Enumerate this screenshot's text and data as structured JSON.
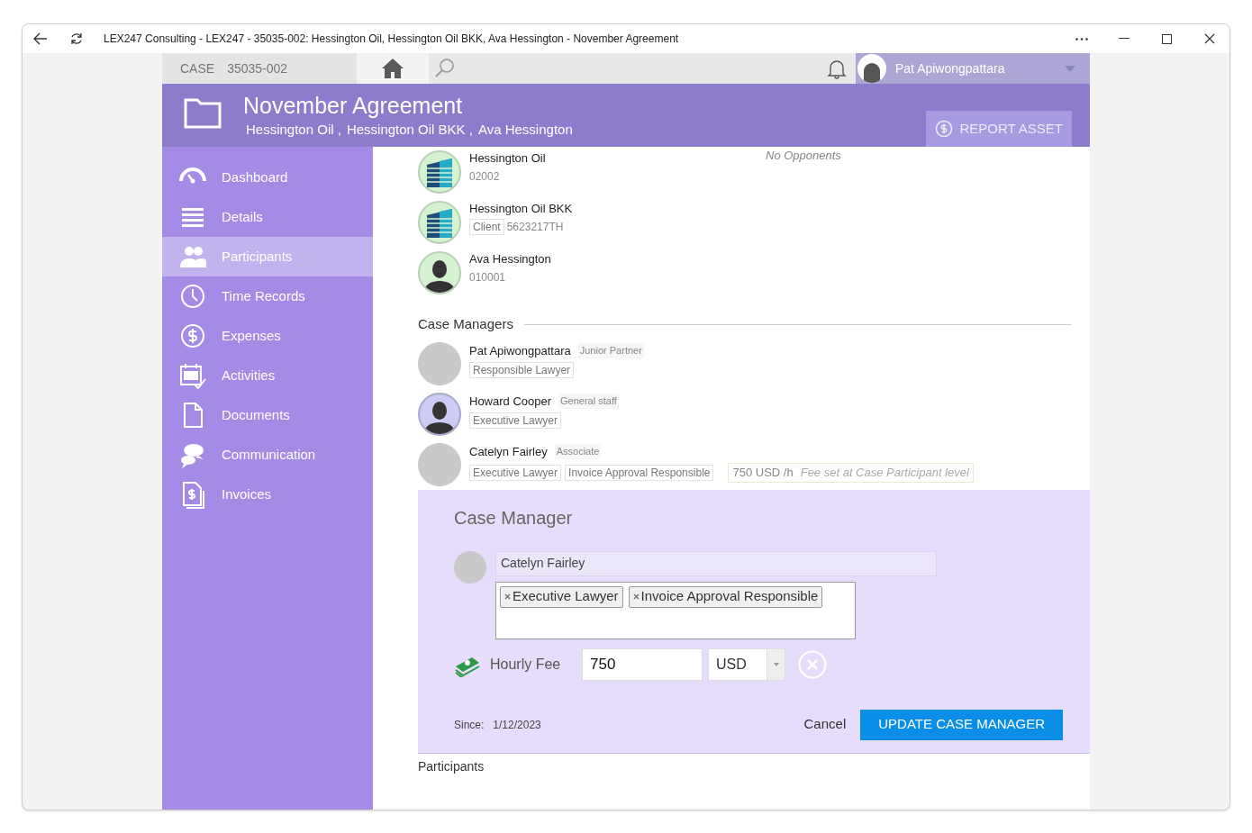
{
  "window": {
    "title": "LEX247 Consulting - LEX247 - 35035-002: Hessington Oil, Hessington Oil BKK, Ava Hessington - November Agreement"
  },
  "topbar": {
    "case_label": "CASE",
    "case_number": "35035-002",
    "user": "Pat Apiwongpattara"
  },
  "header": {
    "title": "November Agreement",
    "subtitle": [
      "Hessington Oil ,",
      "Hessington Oil BKK ,",
      "Ava Hessington"
    ],
    "action": "REPORT ASSET"
  },
  "sidebar": {
    "items": [
      {
        "label": "Dashboard",
        "selected": false
      },
      {
        "label": "Details",
        "selected": false
      },
      {
        "label": "Participants",
        "selected": true
      },
      {
        "label": "Time Records",
        "selected": false
      },
      {
        "label": "Expenses",
        "selected": false
      },
      {
        "label": "Activities",
        "selected": false
      },
      {
        "label": "Documents",
        "selected": false
      },
      {
        "label": "Communication",
        "selected": false
      },
      {
        "label": "Invoices",
        "selected": false
      }
    ]
  },
  "opponents": {
    "empty_text": "No Opponents"
  },
  "clients": [
    {
      "kind": "company",
      "name": "Hessington Oil",
      "code": "02002"
    },
    {
      "kind": "company",
      "name": "Hessington Oil BKK",
      "tags": [
        "Client"
      ],
      "code": "5623217TH"
    },
    {
      "kind": "person",
      "name": "Ava Hessington",
      "code": "010001"
    }
  ],
  "case_managers": {
    "heading": "Case Managers",
    "items": [
      {
        "kind": "photo",
        "name": "Pat Apiwongpattara",
        "title": "Junior Partner",
        "roles": [
          "Responsible Lawyer"
        ]
      },
      {
        "kind": "silhouette",
        "name": "Howard Cooper",
        "title": "General staff",
        "roles": [
          "Executive Lawyer"
        ]
      },
      {
        "kind": "photo",
        "name": "Catelyn Fairley",
        "title": "Associate",
        "roles": [
          "Executive Lawyer",
          "Invoice Approval Responsible"
        ],
        "fee": "750 USD /h",
        "fee_note": "Fee set at Case Participant level"
      }
    ]
  },
  "editor": {
    "title": "Case Manager",
    "name": "Catelyn Fairley",
    "roles": [
      "Executive Lawyer",
      "Invoice Approval Responsible"
    ],
    "fee_label": "Hourly Fee",
    "fee_value": "750",
    "currency": "USD",
    "since_label": "Since:",
    "since": "1/12/2023",
    "cancel": "Cancel",
    "submit": "UPDATE CASE MANAGER"
  },
  "next_section": {
    "heading": "Participants"
  }
}
